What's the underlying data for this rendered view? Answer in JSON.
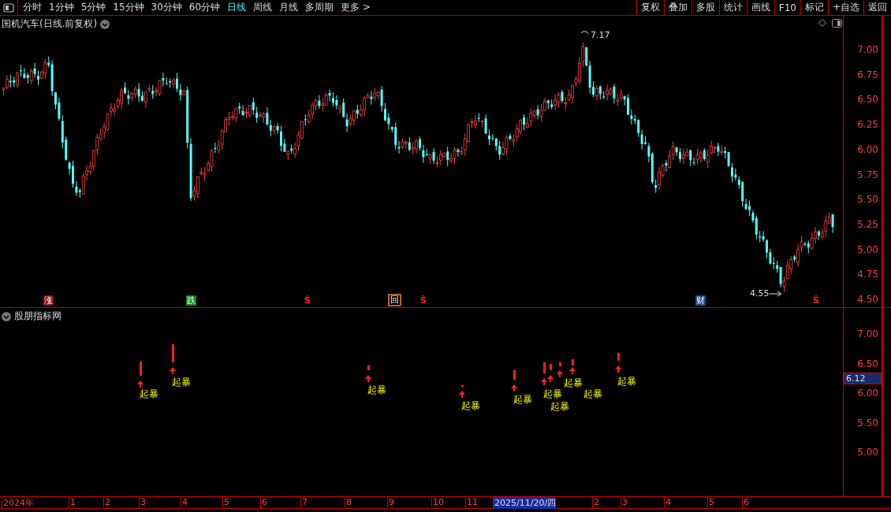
{
  "toolbar": {
    "tabs": [
      {
        "label": "分时",
        "selected": false
      },
      {
        "label": "1分钟",
        "selected": false
      },
      {
        "label": "5分钟",
        "selected": false
      },
      {
        "label": "15分钟",
        "selected": false
      },
      {
        "label": "30分钟",
        "selected": false
      },
      {
        "label": "60分钟",
        "selected": false
      },
      {
        "label": "日线",
        "selected": true
      },
      {
        "label": "周线",
        "selected": false
      },
      {
        "label": "月线",
        "selected": false
      },
      {
        "label": "多周期",
        "selected": false
      },
      {
        "label": "更多 >",
        "selected": false
      }
    ],
    "buttons": [
      "复权",
      "叠加",
      "多股",
      "统计",
      "画线",
      "F10",
      "标记",
      "+自选",
      "返回"
    ]
  },
  "price_panel": {
    "title": "国机汽车(日线.前复权)",
    "high_label": "7.17",
    "low_label": "4.55",
    "axis_labels": [
      "7.00",
      "6.75",
      "6.50",
      "6.25",
      "6.00",
      "5.75",
      "5.50",
      "5.25",
      "5.00",
      "4.75",
      "4.50"
    ],
    "markers": [
      {
        "text": "涨",
        "kind": "rise"
      },
      {
        "text": "跌",
        "kind": "fall"
      },
      {
        "text": "Ŝ",
        "kind": "s"
      },
      {
        "text": "回",
        "kind": "back"
      },
      {
        "text": "Ŝ",
        "kind": "s"
      },
      {
        "text": "财",
        "kind": "finance"
      },
      {
        "text": "Ŝ",
        "kind": "s"
      }
    ]
  },
  "indicator_panel": {
    "title": "股朋指标网",
    "current_value": "6.12",
    "axis_labels": [
      "7.00",
      "6.50",
      "6.00",
      "5.50",
      "5.00"
    ],
    "signals": [
      {
        "label": "起暴"
      },
      {
        "label": "起暴"
      },
      {
        "label": "起暴"
      },
      {
        "label": "起暴"
      },
      {
        "label": "起暴"
      },
      {
        "label": "起暴"
      },
      {
        "label": "起暴"
      },
      {
        "label": "起暴"
      },
      {
        "label": "起暴"
      },
      {
        "label": "起暴"
      }
    ]
  },
  "time_axis": {
    "labels": [
      {
        "text": "2024年",
        "selected": false
      },
      {
        "text": "1",
        "selected": false
      },
      {
        "text": "2",
        "selected": false
      },
      {
        "text": "3",
        "selected": false
      },
      {
        "text": "4",
        "selected": false
      },
      {
        "text": "5",
        "selected": false
      },
      {
        "text": "6",
        "selected": false
      },
      {
        "text": "7",
        "selected": false
      },
      {
        "text": "8",
        "selected": false
      },
      {
        "text": "9",
        "selected": false
      },
      {
        "text": "10",
        "selected": false
      },
      {
        "text": "11",
        "selected": false
      },
      {
        "text": "2025/11/20/四",
        "selected": true
      },
      {
        "text": "2",
        "selected": false
      },
      {
        "text": "3",
        "selected": false
      },
      {
        "text": "4",
        "selected": false
      },
      {
        "text": "5",
        "selected": false
      },
      {
        "text": "6",
        "selected": false
      }
    ]
  }
}
